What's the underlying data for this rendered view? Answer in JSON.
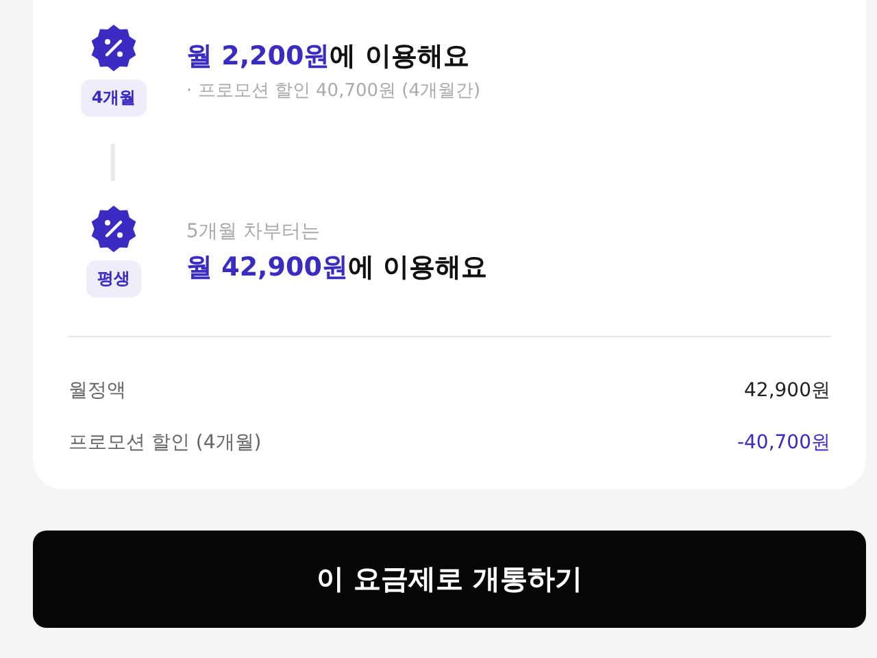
{
  "steps": [
    {
      "badge": "4개월",
      "lines": [
        {
          "kind": "price",
          "price": "월 2,200원",
          "suffix": "에 이용해요"
        },
        {
          "kind": "note",
          "text": "· 프로모션 할인 40,700원 (4개월간)"
        }
      ]
    },
    {
      "badge": "평생",
      "lines": [
        {
          "kind": "caption",
          "text": "5개월 차부터는"
        },
        {
          "kind": "price",
          "price": "월 42,900원",
          "suffix": "에 이용해요"
        }
      ]
    }
  ],
  "summary": [
    {
      "label": "월정액",
      "value": "42,900원",
      "kind": "plain"
    },
    {
      "label": "프로모션 할인 (4개월)",
      "value": "-40,700원",
      "kind": "discount"
    }
  ],
  "button": "이 요금제로 개통하기"
}
